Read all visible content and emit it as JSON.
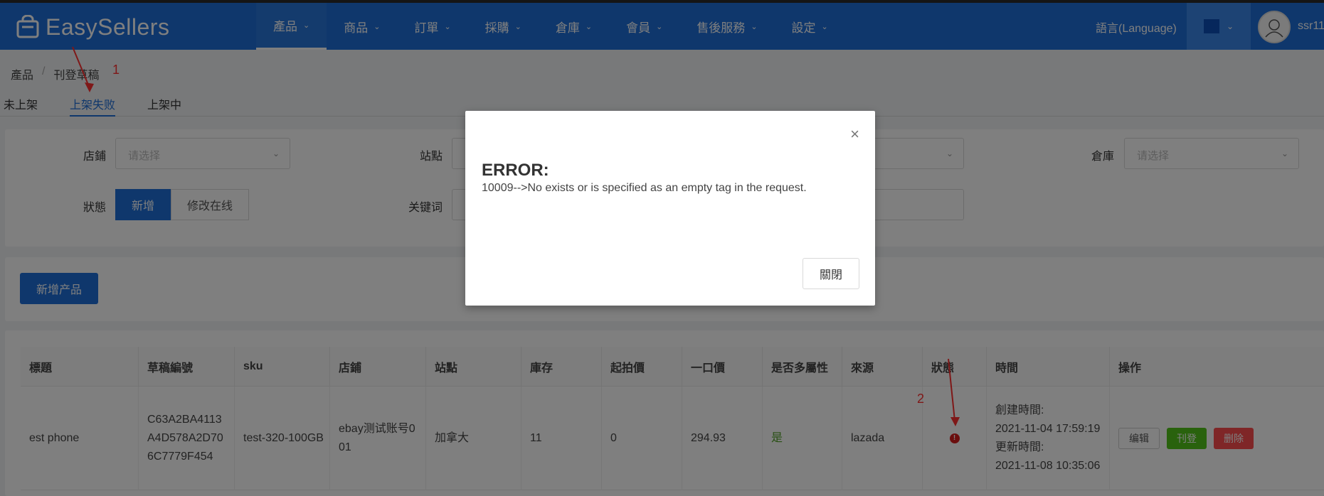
{
  "app": {
    "brand": "EasySellers"
  },
  "nav": {
    "items": [
      "產品",
      "商品",
      "訂單",
      "採購",
      "倉庫",
      "會員",
      "售後服務",
      "設定"
    ],
    "language": "語言(Language)",
    "user": "ssr11"
  },
  "breadcrumb": {
    "root": "產品",
    "sep": "/",
    "current": "刊登草稿"
  },
  "tabs": [
    "未上架",
    "上架失败",
    "上架中"
  ],
  "filters": {
    "store_label": "店鋪",
    "store_placeholder": "请选择",
    "site_label": "站點",
    "warehouse_label": "倉庫",
    "warehouse_placeholder": "请选择",
    "status_label": "狀態",
    "status_options": [
      "新增",
      "修改在线"
    ],
    "keyword_label": "关键词"
  },
  "actions": {
    "add_product": "新增产品"
  },
  "table": {
    "headers": [
      "標題",
      "草稿編號",
      "sku",
      "店鋪",
      "站點",
      "庫存",
      "起拍價",
      "一口價",
      "是否多屬性",
      "來源",
      "狀態",
      "時間",
      "操作"
    ],
    "row": {
      "title": "est phone",
      "draft_no": "C63A2BA4113A4D578A2D706C7779F454",
      "sku": "test-320-100GB",
      "store": "ebay测试账号001",
      "site": "加拿大",
      "stock": "11",
      "start_price": "0",
      "buy_now": "294.93",
      "multi_attr": "是",
      "source": "lazada",
      "status_icon": "error-icon",
      "created_label": "創建時間:",
      "created": "2021-11-04 17:59:19",
      "updated_label": "更新時間:",
      "updated": "2021-11-08 10:35:06",
      "ops": [
        "编辑",
        "刊登",
        "删除"
      ]
    }
  },
  "annotations": {
    "one": "1",
    "two": "2"
  },
  "modal": {
    "title": "ERROR:",
    "message": "10009-->No exists or is specified as an empty tag in the request.",
    "close_button": "關閉",
    "close_icon": "×"
  },
  "colors": {
    "primary": "#1e6fd9",
    "success": "#52c41a",
    "danger": "#ff4d4f",
    "annotation": "#ff3030"
  }
}
